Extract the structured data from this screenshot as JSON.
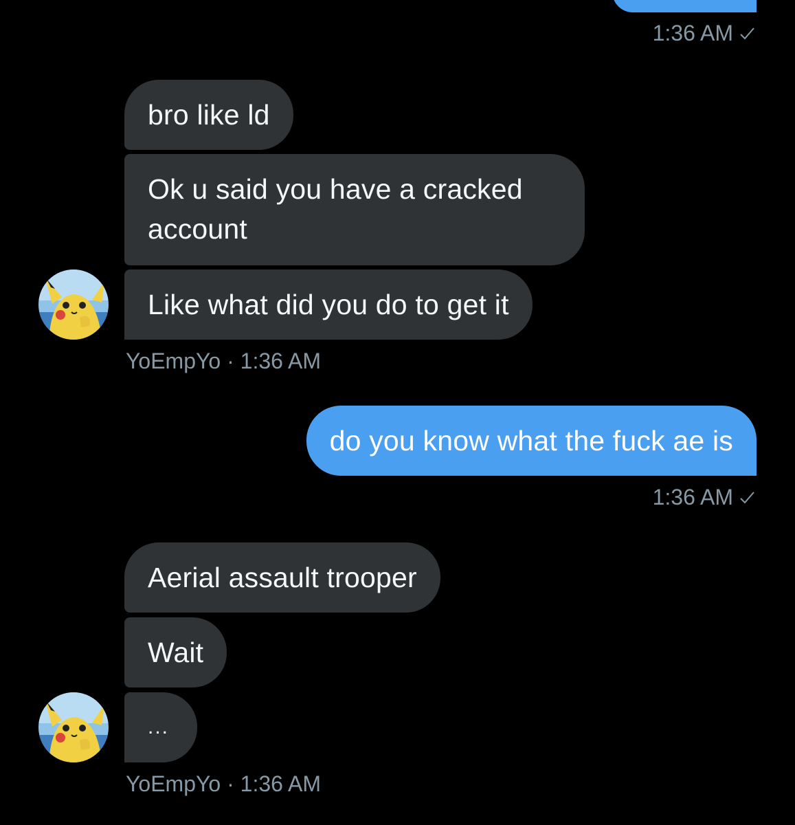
{
  "conversation": {
    "top_outgoing": {
      "time": "1:36 AM"
    },
    "group1": {
      "messages": [
        "bro like ld",
        "Ok u said you have a cracked",
        "account",
        "Like what did you do to get it"
      ],
      "sender": "YoEmpYo",
      "time": "1:36 AM"
    },
    "outgoing1": {
      "text": "do you know what the fuck ae is",
      "time": "1:36 AM"
    },
    "group2": {
      "messages": [
        "Aerial assault trooper",
        "Wait",
        "..."
      ],
      "sender": "YoEmpYo",
      "time": "1:36 AM"
    }
  },
  "colors": {
    "background": "#000000",
    "incoming_bubble": "#2f3336",
    "outgoing_bubble": "#4b9ff0",
    "meta_text": "#8899a6"
  },
  "icons": {
    "avatar": "pikachu-avatar",
    "read_receipt": "check-icon"
  }
}
